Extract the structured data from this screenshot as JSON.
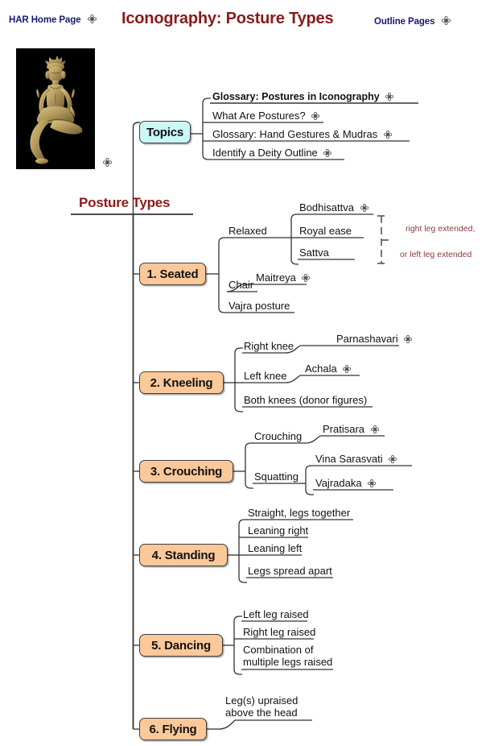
{
  "page": {
    "title": "Iconography: Posture Types",
    "background": "#ffffff",
    "accent_title": "#8b1a1a",
    "accent_link": "#191970",
    "node_topic_color": "#ccf7f7",
    "node_category_color": "#fbc89a",
    "annotation_color": "#8b3a3a"
  },
  "header": {
    "left_link": "HAR Home Page",
    "left_link_icon": "clover-link-icon",
    "title": "Iconography: Posture Types",
    "right_link": "Outline Pages",
    "right_link_icon": "clover-link-icon"
  },
  "thumbnail": {
    "alt": "bronze seated deity figure",
    "icon": "clover-link-icon"
  },
  "topics": {
    "label": "Topics",
    "items": [
      {
        "label": "Glossary: Postures in Iconography",
        "bold": true,
        "icon": "clover-link-icon"
      },
      {
        "label": "What Are Postures?",
        "bold": false,
        "icon": "clover-link-icon"
      },
      {
        "label": "Glossary: Hand Gestures & Mudras",
        "bold": false,
        "icon": "clover-link-icon"
      },
      {
        "label": "Identify a Deity Outline",
        "bold": false,
        "icon": "clover-link-icon"
      }
    ]
  },
  "root": {
    "label": "Posture Types"
  },
  "annotation": {
    "line1": "right leg extended,",
    "line2": "or left leg extended"
  },
  "categories": [
    {
      "id": "seated",
      "label": "1. Seated",
      "branches": [
        {
          "label": "Relaxed",
          "children": [
            {
              "label": "Bodhisattva",
              "icon": "clover-link-icon"
            },
            {
              "label": "Royal ease",
              "icon": null
            },
            {
              "label": "Sattva",
              "icon": null
            }
          ]
        },
        {
          "label": "Chair",
          "children": [
            {
              "label": "Maitreya",
              "icon": "clover-link-icon"
            }
          ]
        },
        {
          "label": "Vajra posture",
          "children": []
        }
      ]
    },
    {
      "id": "kneeling",
      "label": "2. Kneeling",
      "branches": [
        {
          "label": "Right knee",
          "children": [
            {
              "label": "Parnashavari",
              "icon": "clover-link-icon"
            }
          ]
        },
        {
          "label": "Left knee",
          "children": [
            {
              "label": "Achala",
              "icon": "clover-link-icon"
            }
          ]
        },
        {
          "label": "Both knees (donor figures)",
          "children": []
        }
      ]
    },
    {
      "id": "crouching",
      "label": "3. Crouching",
      "branches": [
        {
          "label": "Crouching",
          "children": [
            {
              "label": "Pratisara",
              "icon": "clover-link-icon"
            }
          ]
        },
        {
          "label": "Squatting",
          "children": [
            {
              "label": "Vina Sarasvati",
              "icon": "clover-link-icon"
            },
            {
              "label": "Vajradaka",
              "icon": "clover-link-icon"
            }
          ]
        }
      ]
    },
    {
      "id": "standing",
      "label": "4. Standing",
      "branches": [
        {
          "label": "Straight, legs together",
          "children": []
        },
        {
          "label": "Leaning right",
          "children": []
        },
        {
          "label": "Leaning left",
          "children": []
        },
        {
          "label": "Legs spread apart",
          "children": []
        }
      ]
    },
    {
      "id": "dancing",
      "label": "5. Dancing",
      "branches": [
        {
          "label": "Left leg raised",
          "children": []
        },
        {
          "label": "Right leg raised",
          "children": []
        },
        {
          "label": "Combination of multiple legs raised",
          "children": []
        }
      ]
    },
    {
      "id": "flying",
      "label": "6. Flying",
      "branches": [
        {
          "label": "Leg(s) upraised above the head",
          "children": []
        }
      ]
    }
  ]
}
